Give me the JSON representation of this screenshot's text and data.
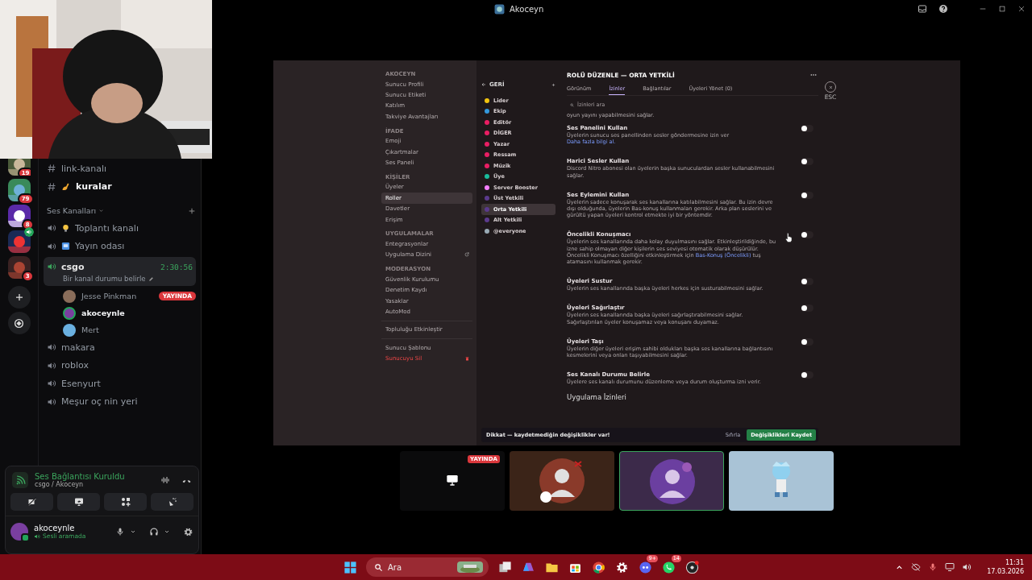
{
  "window": {
    "title": "Akoceyn"
  },
  "webcam": {
    "kind": "picture"
  },
  "sidebar": {
    "servers": [
      {
        "badge": "19",
        "voice": false
      },
      {
        "badge": "79",
        "voice": false
      },
      {
        "badge": "8",
        "voice": false
      },
      {
        "voice": true
      },
      {
        "badge": "3",
        "voice": false
      }
    ],
    "text_channels": [
      {
        "name": "link-kanalı"
      },
      {
        "name": "kuralar",
        "kind": "writing-hand"
      }
    ],
    "voice_header": "Ses Kanalları",
    "voice_channels": [
      {
        "name": "Toplantı kanalı",
        "kind": "bulb",
        "active": false
      },
      {
        "name": "Yayın odası",
        "kind": "screen",
        "active": false
      },
      {
        "name": "csgo",
        "active": true,
        "timer": "2:30:56",
        "status": "Bir kanal durumu belirle",
        "members": [
          {
            "name": "Jesse Pinkman",
            "badge": "YAYINDA",
            "speaking": false
          },
          {
            "name": "akoceynle",
            "speaking": true
          },
          {
            "name": "Mert",
            "speaking": false
          }
        ]
      },
      {
        "name": "makara",
        "active": false
      },
      {
        "name": "roblox",
        "active": false
      },
      {
        "name": "Esenyurt",
        "active": false
      },
      {
        "name": "Meşur oç nin yeri",
        "active": false
      }
    ]
  },
  "voice_panel": {
    "status": "Ses Bağlantısı Kuruldu",
    "location": "csgo / Akoceyn"
  },
  "user_panel": {
    "name": "akoceynle",
    "status": "Sesli aramada"
  },
  "stream": {
    "nav": [
      {
        "header": "AKOCEYN",
        "items": [
          {
            "label": "Sunucu Profili",
            "selected": false
          },
          {
            "label": "Sunucu Etiketi",
            "selected": false
          },
          {
            "label": "Katılım",
            "selected": false
          },
          {
            "label": "Takviye Avantajları",
            "selected": false
          }
        ]
      },
      {
        "header": "İFADE",
        "items": [
          {
            "label": "Emoji",
            "selected": false
          },
          {
            "label": "Çıkartmalar",
            "selected": false
          },
          {
            "label": "Ses Paneli",
            "selected": false
          }
        ]
      },
      {
        "header": "KİŞİLER",
        "items": [
          {
            "label": "Üyeler",
            "selected": false
          },
          {
            "label": "Roller",
            "selected": true
          },
          {
            "label": "Davetler",
            "selected": false
          },
          {
            "label": "Erişim",
            "selected": false
          }
        ]
      },
      {
        "header": "UYGULAMALAR",
        "items": [
          {
            "label": "Entegrasyonlar",
            "selected": false
          },
          {
            "label": "Uygulama Dizini",
            "selected": false,
            "kind": "external"
          }
        ]
      },
      {
        "header": "MODERASYON",
        "items": [
          {
            "label": "Güvenlik Kurulumu",
            "selected": false
          },
          {
            "label": "Denetim Kaydı",
            "selected": false
          },
          {
            "label": "Yasaklar",
            "selected": false
          },
          {
            "label": "AutoMod",
            "selected": false
          }
        ]
      },
      {
        "items": [
          {
            "label": "Topluluğu Etkinleştir",
            "selected": false
          }
        ]
      },
      {
        "items": [
          {
            "label": "Sunucu Şablonu",
            "selected": false
          },
          {
            "label": "Sunucuyu Sil",
            "selected": false,
            "danger": true,
            "kind": "delete"
          }
        ]
      }
    ],
    "back": "GERİ",
    "roles": [
      {
        "name": "Lider",
        "color": "#f1c40f",
        "selected": false
      },
      {
        "name": "Ekip",
        "color": "#3498db",
        "selected": false
      },
      {
        "name": "Editör",
        "color": "#e91e63",
        "selected": false
      },
      {
        "name": "DİGER",
        "color": "#e91e63",
        "selected": false
      },
      {
        "name": "Yazar",
        "color": "#e91e63",
        "selected": false
      },
      {
        "name": "Ressam",
        "color": "#e91e63",
        "selected": false
      },
      {
        "name": "Müzik",
        "color": "#e91e63",
        "selected": false
      },
      {
        "name": "Üye",
        "color": "#1abc9c",
        "selected": false
      },
      {
        "name": "Server Booster",
        "color": "#f47fff",
        "selected": false
      },
      {
        "name": "Üst Yetkili",
        "color": "#5b3a8c",
        "selected": false
      },
      {
        "name": "Orta Yetkili",
        "color": "#5b3a8c",
        "selected": true
      },
      {
        "name": "Alt Yetkili",
        "color": "#5b3a8c",
        "selected": false
      },
      {
        "name": "@everyone",
        "color": "#99aab5",
        "selected": false
      }
    ],
    "title": "ROLÜ DÜZENLE — ORTA YETKİLİ",
    "tabs": [
      {
        "label": "Görünüm",
        "selected": false
      },
      {
        "label": "İzinler",
        "selected": true
      },
      {
        "label": "Bağlantılar",
        "selected": false
      },
      {
        "label": "Üyeleri Yönet (0)",
        "selected": false
      }
    ],
    "esc": "ESC",
    "search": {
      "placeholder": "İzinleri ara"
    },
    "intro": "oyun yayını yapabilmesini sağlar.",
    "permissions": [
      {
        "name": "Ses Panelini Kullan",
        "description": "Üyelerin sunucu ses panellinden sesler göndermesine izin ver",
        "link": "Daha fazla bilgi al.",
        "on": false
      },
      {
        "name": "Harici Sesler Kullan",
        "description": "Discord Nitro abonesi olan üyelerin başka sunuculardan sesler kullanabilmesini sağlar.",
        "on": false
      },
      {
        "name": "Ses Eylemini Kullan",
        "description": "Üyelerin sadece konuşarak ses kanallarına katılabilmesini sağlar. Bu izin devre dışı olduğunda, üyelerin Bas-konuş kullanmaları gerekir. Arka plan seslerini ve gürültü yapan üyeleri kontrol etmekte iyi bir yöntemdir.",
        "on": false
      },
      {
        "name": "Öncelikli Konuşmacı",
        "description": "Üyelerin ses kanallarında daha kolay duyulmasını sağlar. Etkinleştirildiğinde, bu izne sahip olmayan diğer kişilerin ses seviyesi otomatik olarak düşürülür. Öncelikli Konuşmacı özelliğini etkinleştirmek için",
        "link": "Bas-Konuş (Öncelikli)",
        "after": "tuş atamasını kullanmak gerekir.",
        "on": false
      },
      {
        "name": "Üyeleri Sustur",
        "description": "Üyelerin ses kanallarında başka üyeleri herkes için susturabilmesini sağlar.",
        "on": false
      },
      {
        "name": "Üyeleri Sağırlaştır",
        "description": "Üyelerin ses kanallarında başka üyeleri sağırlaştırabilmesini sağlar. Sağırlaştırılan üyeler konuşamaz veya konuşanı duyamaz.",
        "on": false
      },
      {
        "name": "Üyeleri Taşı",
        "description": "Üyelerin diğer üyeleri erişim sahibi oldukları başka ses kanallarına bağlantısını kesmelerini veya onları taşıyabilmesini sağlar.",
        "on": false
      },
      {
        "name": "Ses Kanalı Durumu Belirle",
        "description": "Üyelere ses kanalı durumunu düzenleme veya durum oluşturma izni verir.",
        "on": false
      }
    ],
    "section": "Uygulama İzinleri",
    "save_bar": {
      "message": "Dikkat — kaydetmediğin değişiklikler var!",
      "reset": "Sıfırla",
      "save": "Değişiklikleri Kaydet"
    }
  },
  "tiles": [
    {
      "kind": "screen",
      "badge": "YAYINDA",
      "selected": false
    },
    {
      "kind": "picture",
      "selected": false
    },
    {
      "kind": "picture",
      "selected": true
    },
    {
      "kind": "picture",
      "selected": false
    }
  ],
  "taskbar": {
    "search": {
      "placeholder": "Ara"
    },
    "discord_badge": "9+",
    "whatsapp_badge": "14",
    "time": "11:31",
    "date": "17.03.2026"
  }
}
